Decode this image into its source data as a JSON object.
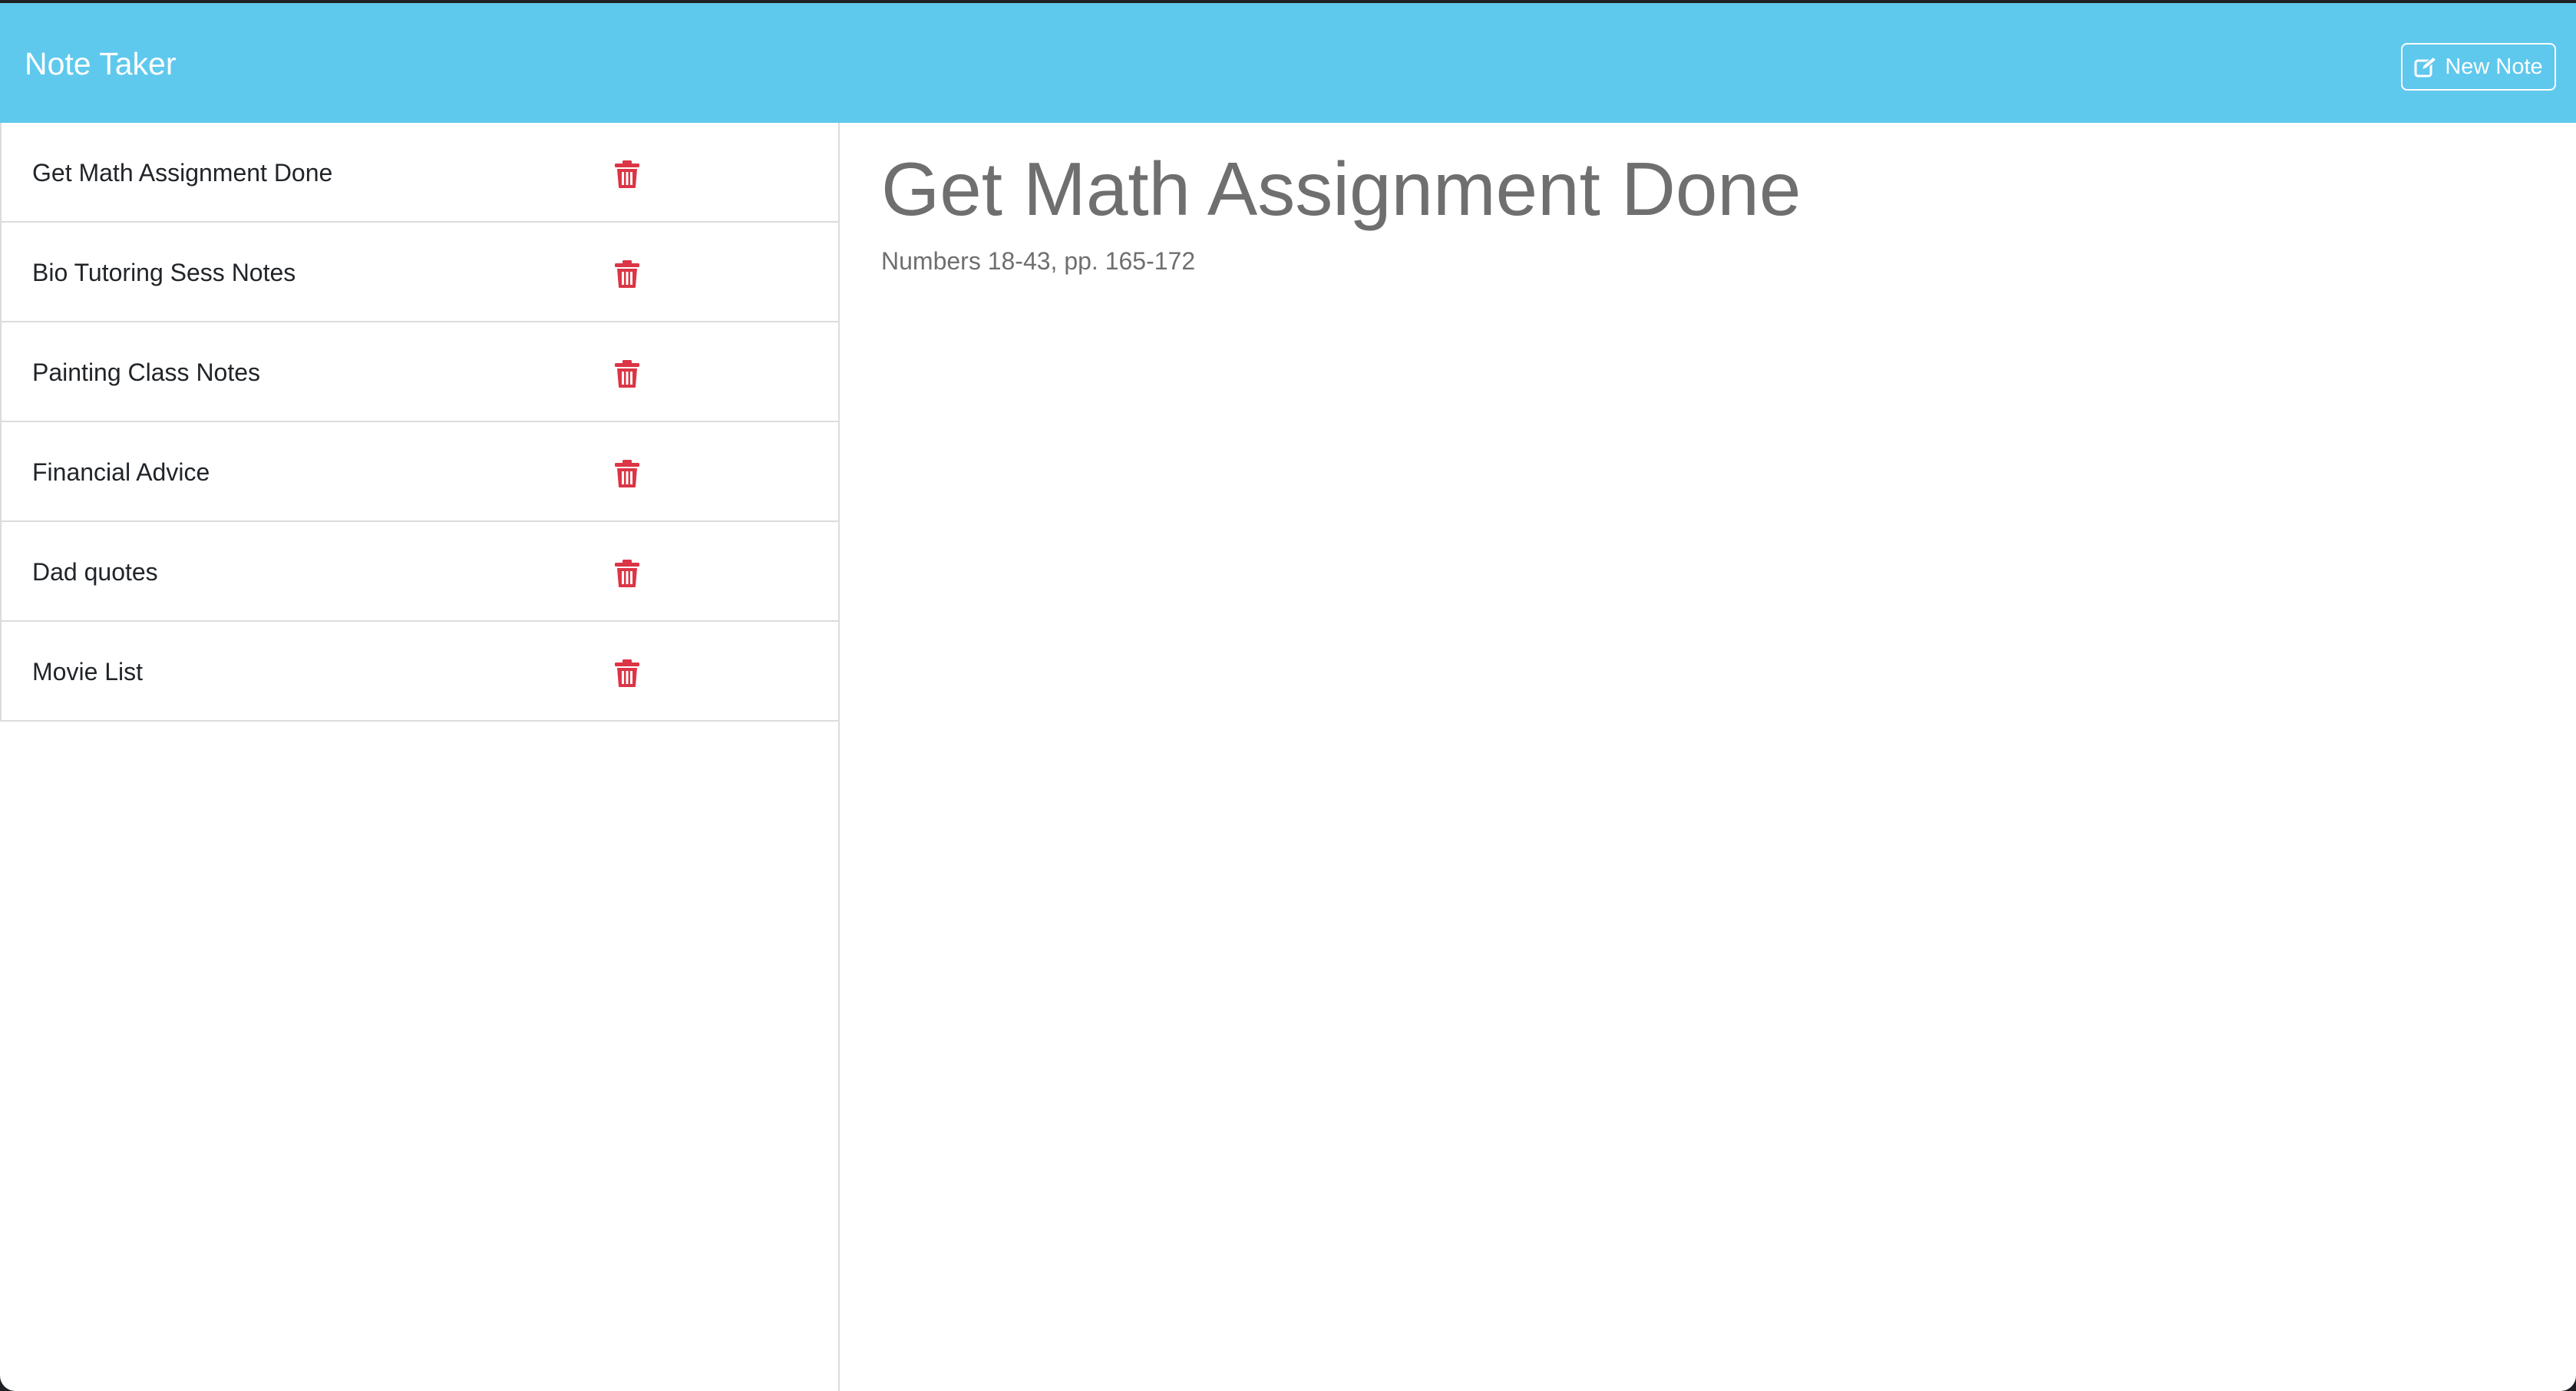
{
  "navbar": {
    "brand": "Note Taker",
    "new_note_label": "New Note",
    "new_note_icon": "edit-icon",
    "background_color": "#5fc8ed"
  },
  "notes": [
    {
      "title": "Get Math Assignment Done",
      "icon": "trash-icon"
    },
    {
      "title": "Bio Tutoring Sess Notes",
      "icon": "trash-icon"
    },
    {
      "title": "Painting Class Notes",
      "icon": "trash-icon"
    },
    {
      "title": "Financial Advice",
      "icon": "trash-icon"
    },
    {
      "title": "Dad quotes",
      "icon": "trash-icon"
    },
    {
      "title": "Movie List",
      "icon": "trash-icon"
    }
  ],
  "active_note": {
    "title": "Get Math Assignment Done",
    "text": "Numbers 18-43, pp. 165-172"
  },
  "colors": {
    "delete_icon": "#dc3545",
    "note_text": "#6f6f6f"
  }
}
